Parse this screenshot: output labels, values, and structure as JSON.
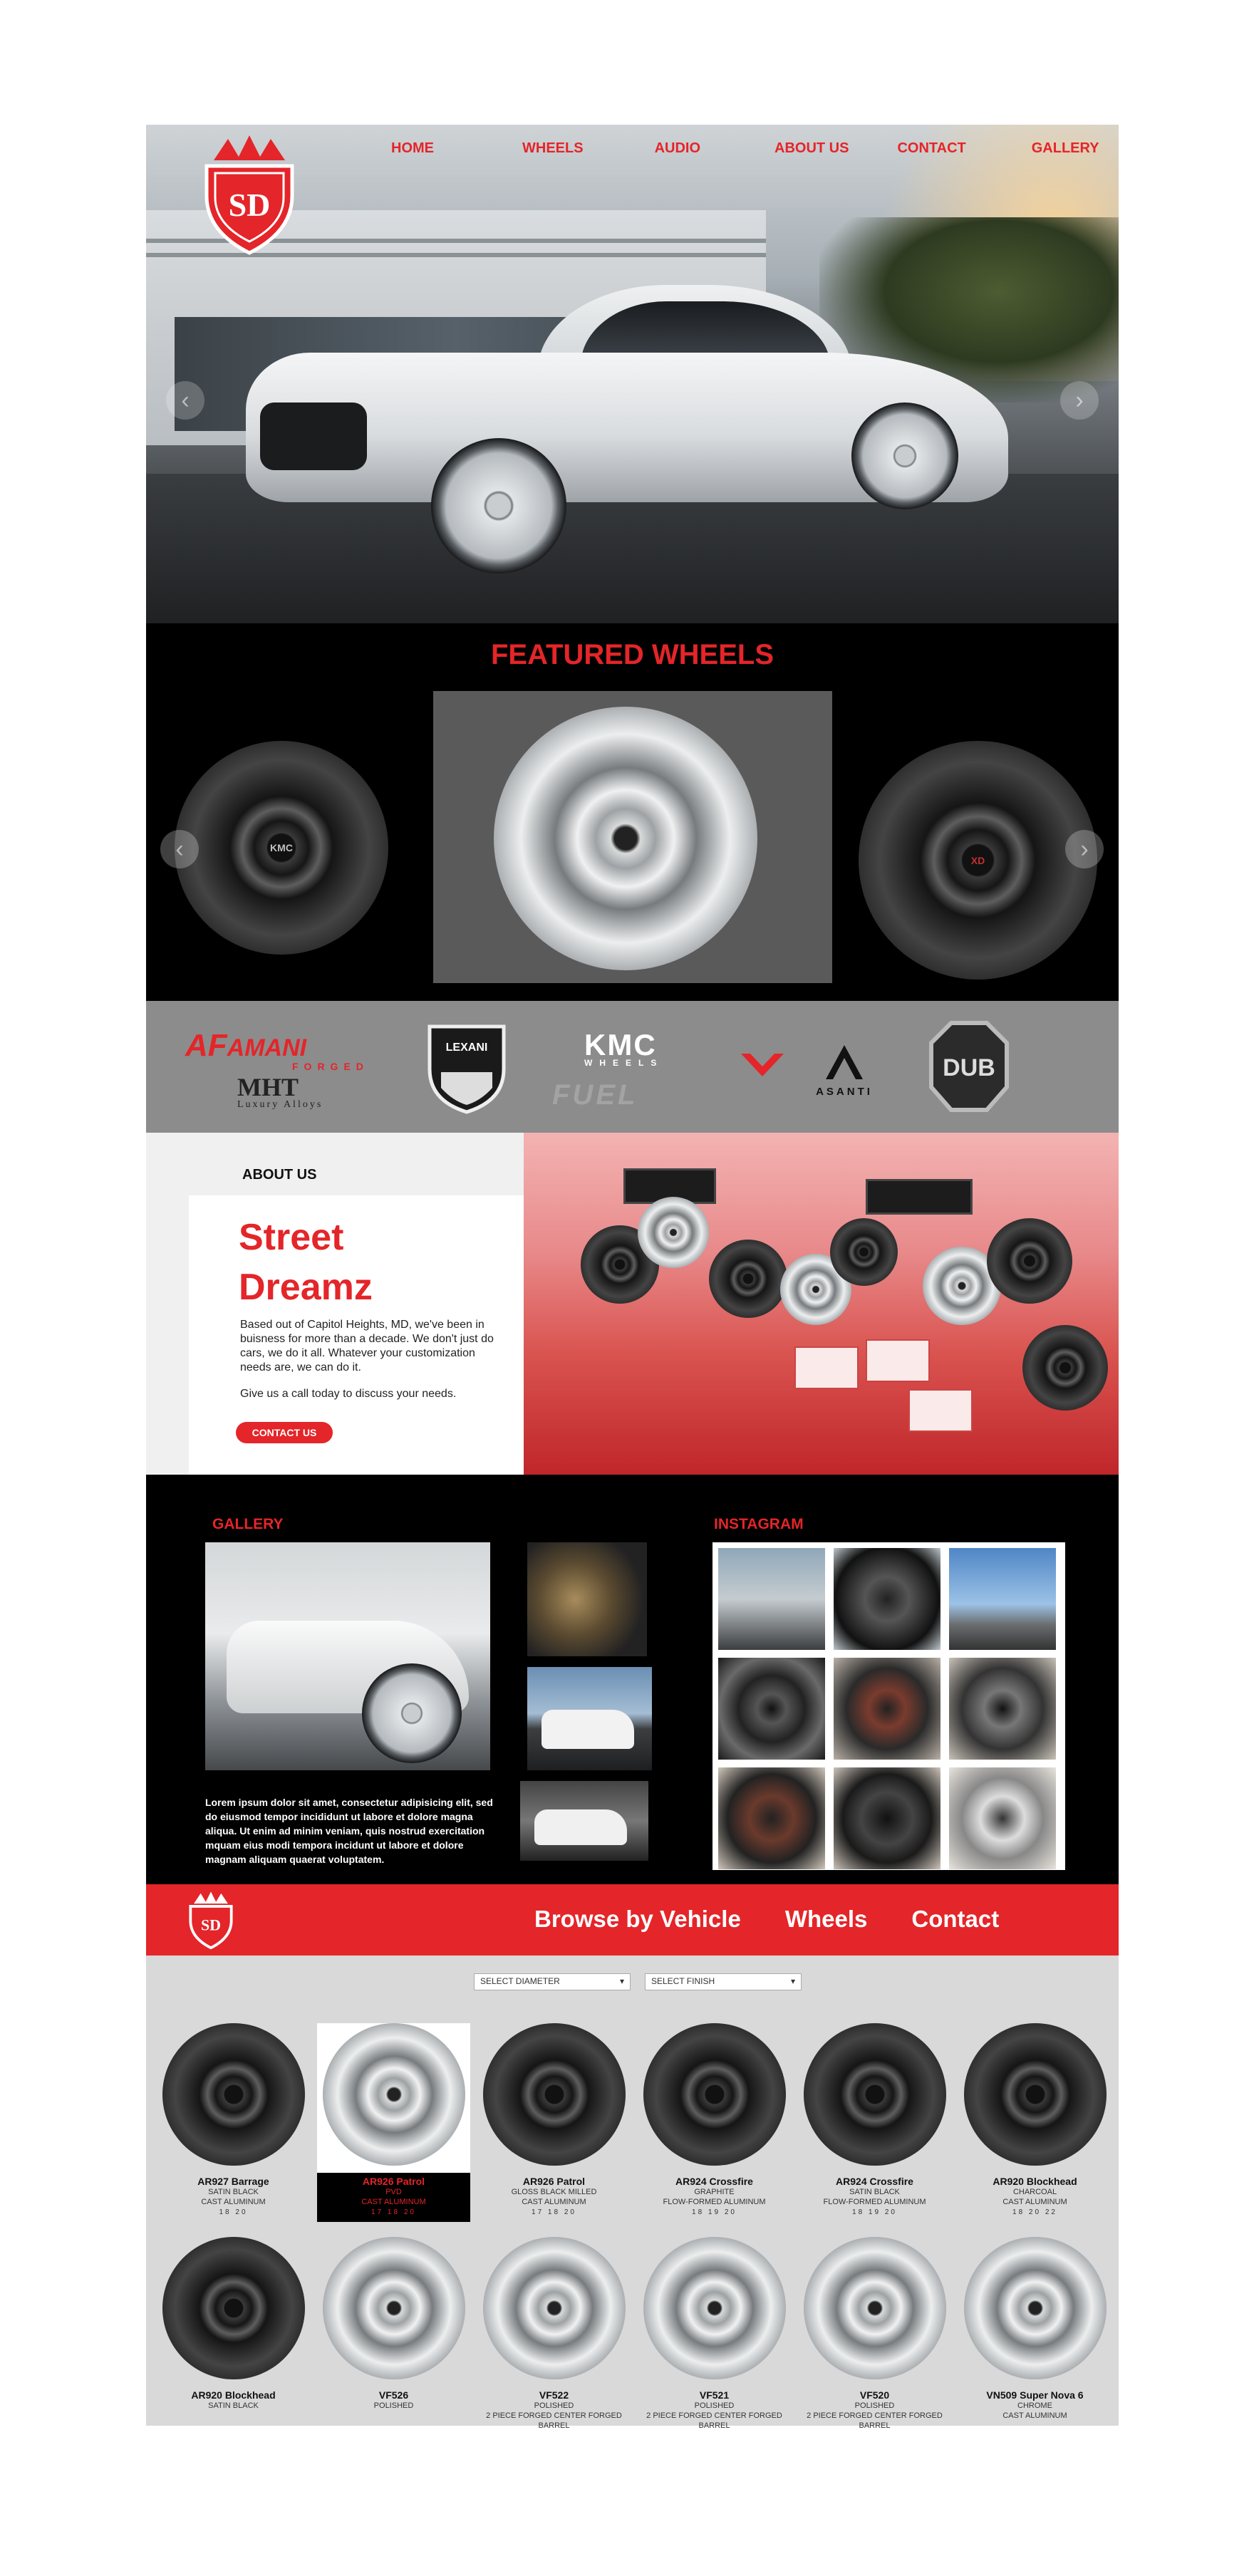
{
  "nav": {
    "items": [
      "HOME",
      "WHEELS",
      "AUDIO",
      "ABOUT US",
      "CONTACT",
      "GALLERY"
    ]
  },
  "logo": {
    "text": "SD",
    "color": "#e42529"
  },
  "hero": {
    "prev_icon": "chevron-left-icon",
    "next_icon": "chevron-right-icon",
    "prev_glyph": "‹",
    "next_glyph": "›"
  },
  "featured": {
    "title": "FEATURED WHEELS",
    "left_badge": "KMC",
    "right_badge": "XD"
  },
  "brands": {
    "amani": "AMANI",
    "amani_prefix": "AF",
    "amani_sub": "FORGED",
    "lexani": "LEXANI",
    "kmc": "KMC",
    "kmc_sub": "WHEELS",
    "mht": "MHT",
    "mht_sub": "Luxury Alloys",
    "fuel": "FUEL",
    "asanti": "ASANTI",
    "dub": "DUB"
  },
  "about": {
    "heading": "ABOUT US",
    "brand_line1": "Street",
    "brand_line2": "Dreamz",
    "body": "Based out of Capitol Heights, MD, we've been in buisness for more than a decade. We don't just do cars, we do it all. Whatever your customization needs are, we can do it.",
    "cta_text": "Give us a call today to discuss your needs.",
    "button": "CONTACT US"
  },
  "gallery": {
    "title": "GALLERY",
    "text": "Lorem ipsum dolor sit amet, consectetur adipisicing elit, sed do eiusmod tempor incididunt ut labore et dolore magna aliqua. Ut enim ad minim veniam, quis nostrud exercitation mquam eius modi tempora incidunt ut labore et dolore magnam aliquam quaerat voluptatem."
  },
  "instagram": {
    "title": "INSTAGRAM"
  },
  "browse": {
    "items": [
      "Browse by Vehicle",
      "Wheels",
      "Contact"
    ]
  },
  "filters": {
    "diameter": "SELECT DIAMETER",
    "finish": "SELECT FINISH",
    "chevron": "▾"
  },
  "products": [
    {
      "name": "AR927 Barrage",
      "finish": "SATIN BLACK",
      "type": "CAST ALUMINUM",
      "sizes": "18  20",
      "style": "dark"
    },
    {
      "name": "AR926 Patrol",
      "finish": "PVD",
      "type": "CAST ALUMINUM",
      "sizes": "17  18  20",
      "style": "chrome",
      "active": true
    },
    {
      "name": "AR926 Patrol",
      "finish": "GLOSS BLACK MILLED",
      "type": "CAST ALUMINUM",
      "sizes": "17  18  20",
      "style": "dark"
    },
    {
      "name": "AR924 Crossfire",
      "finish": "GRAPHITE",
      "type": "FLOW-FORMED ALUMINUM",
      "sizes": "18  19  20",
      "style": "dark"
    },
    {
      "name": "AR924 Crossfire",
      "finish": "SATIN BLACK",
      "type": "FLOW-FORMED ALUMINUM",
      "sizes": "18  19  20",
      "style": "dark"
    },
    {
      "name": "AR920 Blockhead",
      "finish": "CHARCOAL",
      "type": "CAST ALUMINUM",
      "sizes": "18  20  22",
      "style": "dark"
    },
    {
      "name": "AR920 Blockhead",
      "finish": "SATIN BLACK",
      "type": "",
      "sizes": "",
      "style": "dark"
    },
    {
      "name": "VF526",
      "finish": "POLISHED",
      "type": "",
      "sizes": "",
      "style": "chrome"
    },
    {
      "name": "VF522",
      "finish": "POLISHED",
      "type": "2 PIECE FORGED CENTER FORGED BARREL",
      "sizes": "",
      "style": "chrome"
    },
    {
      "name": "VF521",
      "finish": "POLISHED",
      "type": "2 PIECE FORGED CENTER FORGED BARREL",
      "sizes": "",
      "style": "chrome"
    },
    {
      "name": "VF520",
      "finish": "POLISHED",
      "type": "2 PIECE FORGED CENTER FORGED BARREL",
      "sizes": "",
      "style": "chrome"
    },
    {
      "name": "VN509 Super Nova 6",
      "finish": "CHROME",
      "type": "CAST ALUMINUM",
      "sizes": "",
      "style": "chrome"
    }
  ],
  "colors": {
    "accent": "#e42529",
    "dark": "#000000",
    "panel": "#8c8c8c"
  }
}
